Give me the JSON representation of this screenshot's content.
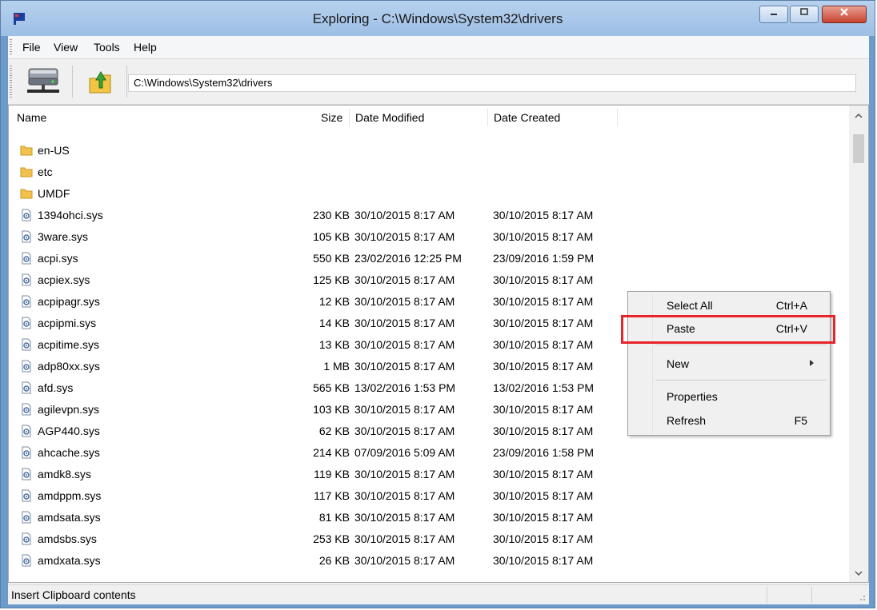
{
  "window": {
    "title": "Exploring - C:\\Windows\\System32\\drivers"
  },
  "menu": [
    "File",
    "View",
    "Tools",
    "Help"
  ],
  "toolbar": {
    "address": "C:\\Windows\\System32\\drivers",
    "icons": [
      "drive-icon",
      "up-folder-icon"
    ]
  },
  "columns": [
    "Name",
    "Size",
    "Date Modified",
    "Date Created"
  ],
  "files": [
    {
      "name": "en-US",
      "type": "folder",
      "size": "",
      "modified": "",
      "created": ""
    },
    {
      "name": "etc",
      "type": "folder",
      "size": "",
      "modified": "",
      "created": ""
    },
    {
      "name": "UMDF",
      "type": "folder",
      "size": "",
      "modified": "",
      "created": ""
    },
    {
      "name": "1394ohci.sys",
      "type": "file",
      "size": "230 KB",
      "modified": "30/10/2015 8:17 AM",
      "created": "30/10/2015 8:17 AM"
    },
    {
      "name": "3ware.sys",
      "type": "file",
      "size": "105 KB",
      "modified": "30/10/2015 8:17 AM",
      "created": "30/10/2015 8:17 AM"
    },
    {
      "name": "acpi.sys",
      "type": "file",
      "size": "550 KB",
      "modified": "23/02/2016 12:25 PM",
      "created": "23/09/2016 1:59 PM"
    },
    {
      "name": "acpiex.sys",
      "type": "file",
      "size": "125 KB",
      "modified": "30/10/2015 8:17 AM",
      "created": "30/10/2015 8:17 AM"
    },
    {
      "name": "acpipagr.sys",
      "type": "file",
      "size": "12 KB",
      "modified": "30/10/2015 8:17 AM",
      "created": "30/10/2015 8:17 AM"
    },
    {
      "name": "acpipmi.sys",
      "type": "file",
      "size": "14 KB",
      "modified": "30/10/2015 8:17 AM",
      "created": "30/10/2015 8:17 AM"
    },
    {
      "name": "acpitime.sys",
      "type": "file",
      "size": "13 KB",
      "modified": "30/10/2015 8:17 AM",
      "created": "30/10/2015 8:17 AM"
    },
    {
      "name": "adp80xx.sys",
      "type": "file",
      "size": "1 MB",
      "modified": "30/10/2015 8:17 AM",
      "created": "30/10/2015 8:17 AM"
    },
    {
      "name": "afd.sys",
      "type": "file",
      "size": "565 KB",
      "modified": "13/02/2016 1:53 PM",
      "created": "13/02/2016 1:53 PM"
    },
    {
      "name": "agilevpn.sys",
      "type": "file",
      "size": "103 KB",
      "modified": "30/10/2015 8:17 AM",
      "created": "30/10/2015 8:17 AM"
    },
    {
      "name": "AGP440.sys",
      "type": "file",
      "size": "62 KB",
      "modified": "30/10/2015 8:17 AM",
      "created": "30/10/2015 8:17 AM"
    },
    {
      "name": "ahcache.sys",
      "type": "file",
      "size": "214 KB",
      "modified": "07/09/2016 5:09 AM",
      "created": "23/09/2016 1:58 PM"
    },
    {
      "name": "amdk8.sys",
      "type": "file",
      "size": "119 KB",
      "modified": "30/10/2015 8:17 AM",
      "created": "30/10/2015 8:17 AM"
    },
    {
      "name": "amdppm.sys",
      "type": "file",
      "size": "117 KB",
      "modified": "30/10/2015 8:17 AM",
      "created": "30/10/2015 8:17 AM"
    },
    {
      "name": "amdsata.sys",
      "type": "file",
      "size": "81 KB",
      "modified": "30/10/2015 8:17 AM",
      "created": "30/10/2015 8:17 AM"
    },
    {
      "name": "amdsbs.sys",
      "type": "file",
      "size": "253 KB",
      "modified": "30/10/2015 8:17 AM",
      "created": "30/10/2015 8:17 AM"
    },
    {
      "name": "amdxata.sys",
      "type": "file",
      "size": "26 KB",
      "modified": "30/10/2015 8:17 AM",
      "created": "30/10/2015 8:17 AM"
    }
  ],
  "context_menu": {
    "items": [
      {
        "label": "Select All",
        "shortcut": "Ctrl+A"
      },
      {
        "label": "Paste",
        "shortcut": "Ctrl+V"
      },
      {
        "label": "New",
        "shortcut": ""
      },
      {
        "label": "Properties",
        "shortcut": ""
      },
      {
        "label": "Refresh",
        "shortcut": "F5"
      }
    ],
    "highlighted": "Paste"
  },
  "status": {
    "text": "Insert Clipboard contents"
  },
  "colors": {
    "highlight": "#e8232a",
    "title_bar": "#a9c7ea",
    "close_button": "#c8432e"
  }
}
